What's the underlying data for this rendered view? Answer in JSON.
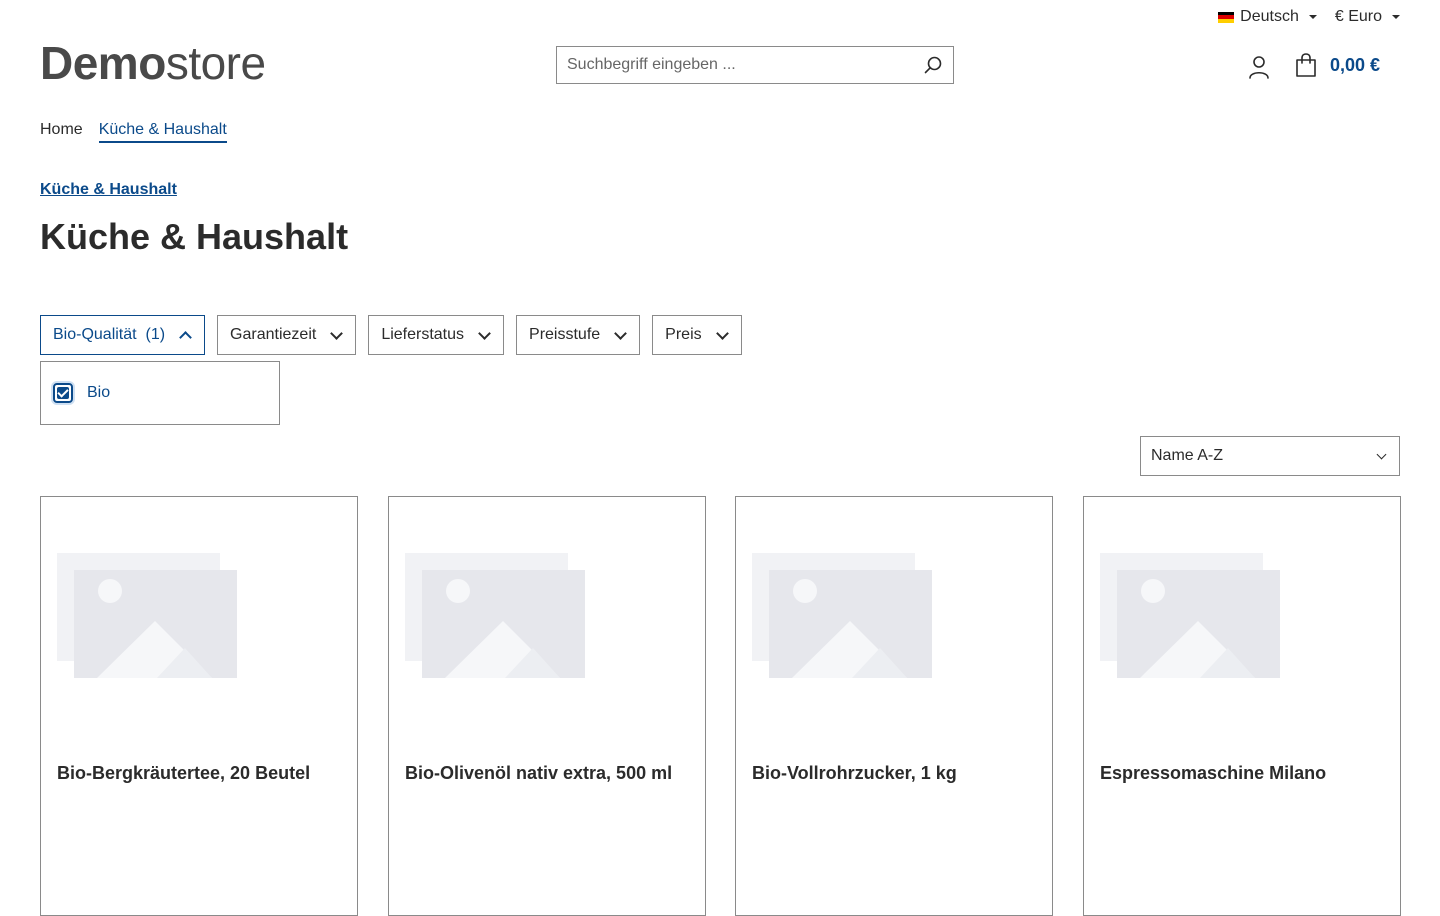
{
  "topbar": {
    "language": "Deutsch",
    "currency": "€ Euro"
  },
  "logo": {
    "bold": "Demo",
    "light": "store"
  },
  "search": {
    "placeholder": "Suchbegriff eingeben ..."
  },
  "cart": {
    "total": "0,00 €"
  },
  "breadcrumb": {
    "home": "Home",
    "current": "Küche & Haushalt"
  },
  "category": {
    "link": "Küche & Haushalt",
    "title": "Küche & Haushalt"
  },
  "filters": {
    "bio": "Bio-Qualität",
    "bio_count": "(1)",
    "garantie": "Garantiezeit",
    "liefer": "Lieferstatus",
    "preisstufe": "Preisstufe",
    "preis": "Preis",
    "panel_option": "Bio"
  },
  "sort": {
    "selected": "Name A-Z"
  },
  "products": [
    {
      "name": "Bio-Bergkräutertee, 20 Beutel"
    },
    {
      "name": "Bio-Olivenöl nativ extra, 500 ml"
    },
    {
      "name": "Bio-Vollrohrzucker, 1 kg"
    },
    {
      "name": "Espressomaschine Milano"
    }
  ],
  "colors": {
    "accent": "#0b4a8a",
    "border": "#8a8a8a",
    "text": "#2b2b2b"
  }
}
